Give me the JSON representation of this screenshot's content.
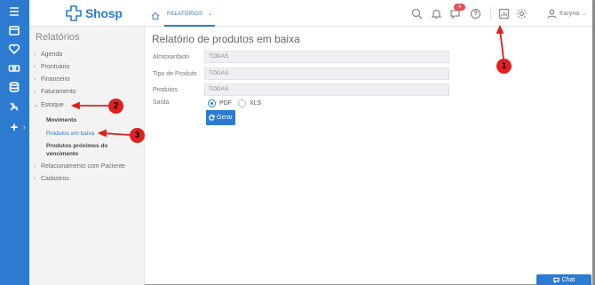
{
  "app": {
    "logo_text": "Shosp",
    "brand_color": "#2d7bd1"
  },
  "rail": {
    "icons": [
      "menu-icon",
      "calendar-icon",
      "heart-icon",
      "money-icon",
      "database-icon",
      "tools-icon"
    ],
    "add_label": "+",
    "add_chevron": "›"
  },
  "header": {
    "tab_label": "RELATÓRIOS",
    "tab_chevron": "⌄",
    "notification_badge": "4",
    "user_name": "Karyna",
    "user_chevron": "⌄"
  },
  "sidebar": {
    "title": "Relatórios",
    "items": [
      {
        "label": "Agenda",
        "caret": "›"
      },
      {
        "label": "Prontuário",
        "caret": "›"
      },
      {
        "label": "Financeiro",
        "caret": "›"
      },
      {
        "label": "Faturamento",
        "caret": "›"
      },
      {
        "label": "Estoque",
        "caret": "⌄"
      },
      {
        "label": "Relacionamento com Paciente",
        "caret": "›"
      },
      {
        "label": "Cadastros",
        "caret": "›"
      }
    ],
    "subitems": [
      {
        "label": "Movimento"
      },
      {
        "label": "Produtos em baixa"
      },
      {
        "label": "Produtos próximos do vencimento"
      }
    ]
  },
  "main": {
    "title": "Relatório de produtos em baixa",
    "fields": [
      {
        "label": "Almoxarifado",
        "value": "TODAS"
      },
      {
        "label": "Tipo de Produto",
        "value": "TODAS"
      },
      {
        "label": "Produtos",
        "value": "TODAS"
      }
    ],
    "output": {
      "label": "Saída",
      "options": [
        "PDF",
        "XLS"
      ],
      "selected": "PDF"
    },
    "generate_label": "Gerar"
  },
  "chat": {
    "label": "Chat"
  },
  "annotations": {
    "markers": [
      "1",
      "2",
      "3"
    ],
    "color": "#e02020"
  }
}
